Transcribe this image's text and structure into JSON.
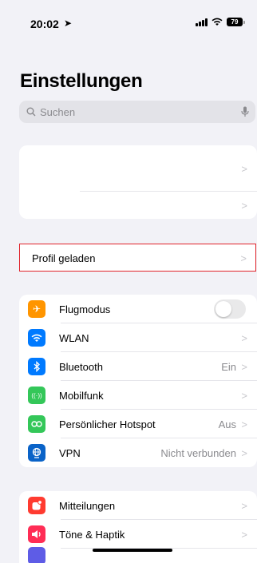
{
  "status_bar": {
    "time": "20:02",
    "battery": "79"
  },
  "header": {
    "title": "Einstellungen"
  },
  "search": {
    "placeholder": "Suchen"
  },
  "account_group": {
    "rows": [
      {
        "label": ""
      },
      {
        "label": ""
      }
    ]
  },
  "profile": {
    "label": "Profil geladen"
  },
  "connectivity": {
    "items": [
      {
        "label": "Flugmodus",
        "icon": "airplane-icon",
        "color": "#ff9500",
        "toggle": false
      },
      {
        "label": "WLAN",
        "icon": "wifi-icon",
        "color": "#007aff"
      },
      {
        "label": "Bluetooth",
        "value": "Ein",
        "icon": "bluetooth-icon",
        "color": "#007aff"
      },
      {
        "label": "Mobilfunk",
        "icon": "antenna-icon",
        "color": "#34c759"
      },
      {
        "label": "Persönlicher Hotspot",
        "value": "Aus",
        "icon": "hotspot-icon",
        "color": "#34c759"
      },
      {
        "label": "VPN",
        "value": "Nicht verbunden",
        "icon": "globe-icon",
        "color": "#0a63c8"
      }
    ]
  },
  "notifications": {
    "items": [
      {
        "label": "Mitteilungen",
        "icon": "notification-icon",
        "color": "#ff3b30"
      },
      {
        "label": "Töne & Haptik",
        "icon": "speaker-icon",
        "color": "#ff2d55"
      }
    ]
  },
  "colors": {
    "highlight_border": "#e0242b",
    "background": "#f2f2f7"
  }
}
